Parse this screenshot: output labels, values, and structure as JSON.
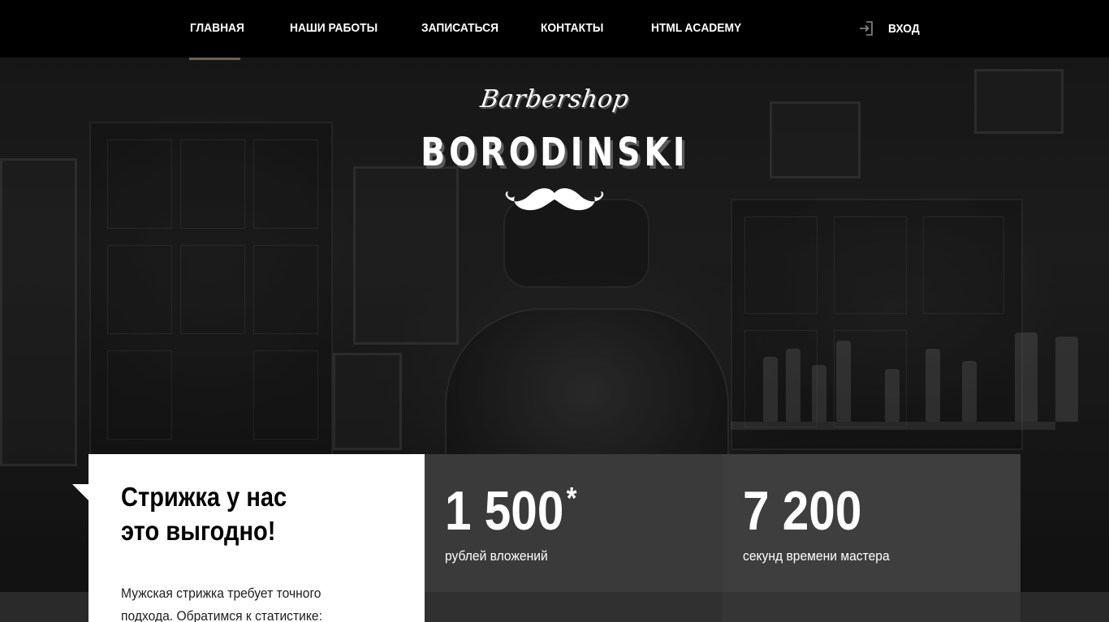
{
  "nav": {
    "items": [
      {
        "label": "Главная",
        "active": true
      },
      {
        "label": "Наши работы"
      },
      {
        "label": "Записаться"
      },
      {
        "label": "Контакты"
      },
      {
        "label": "HTML Academy"
      }
    ],
    "login_label": "Вход",
    "login_icon": "login-icon",
    "active_underline_color": "#6f5f55"
  },
  "logo": {
    "script": "Barbershop",
    "name": "BORODINSKI",
    "icon": "mustache-icon"
  },
  "promo": {
    "title_line1": "Стрижка у нас",
    "title_line2": "это выгодно!",
    "text_line1": "Мужская стрижка требует точного",
    "text_line2": "подхода. Обратимся к статистике:"
  },
  "stats": [
    {
      "value": "1 500",
      "mark": "*",
      "label": "рублей вложений"
    },
    {
      "value": "7 200",
      "label": "секунд времени мастера"
    }
  ]
}
